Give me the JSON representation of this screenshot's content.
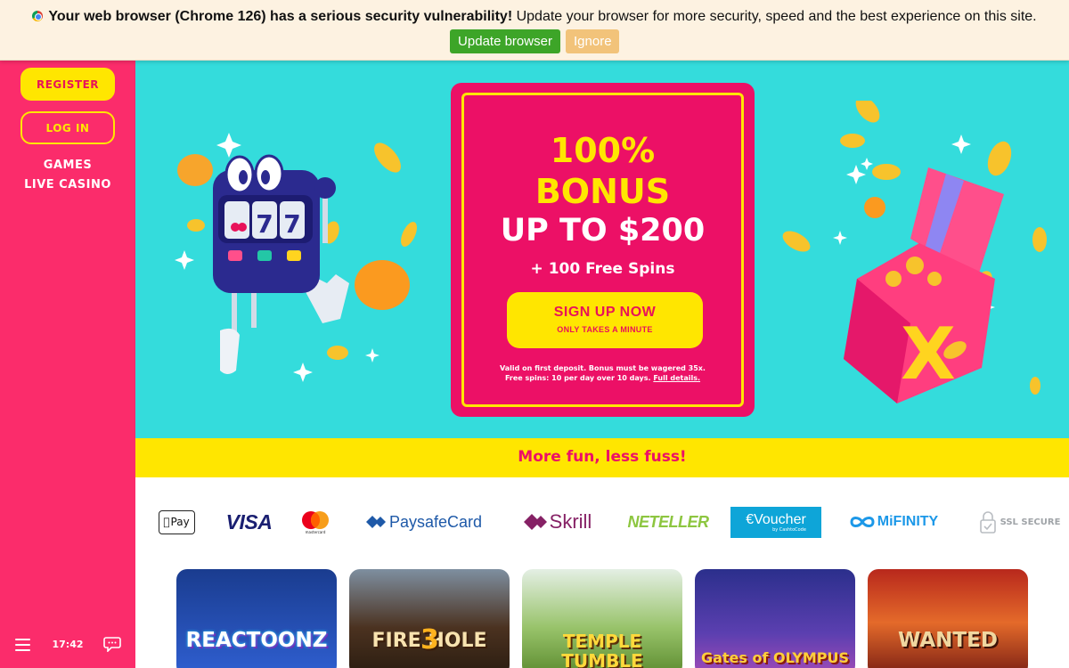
{
  "browser_bar": {
    "message_bold": "Your web browser (Chrome 126) has a serious security vulnerability!",
    "message_rest": " Update your browser for more security, speed and the best experience on this site.",
    "update_label": "Update browser",
    "ignore_label": "Ignore"
  },
  "sidebar": {
    "register_label": "REGISTER",
    "login_label": "LOG IN",
    "nav": [
      "GAMES",
      "LIVE CASINO"
    ],
    "clock": "17:42",
    "menu_icon": "hamburger-icon",
    "chat_icon": "chat-icon"
  },
  "hero": {
    "line1": "100%",
    "line2": "BONUS",
    "line3": "UP TO $200",
    "line4": "+ 100 Free Spins",
    "cta_title": "SIGN UP NOW",
    "cta_sub": "ONLY TAKES A MINUTE",
    "terms_line1": "Valid on first deposit. Bonus must be wagered 35x.",
    "terms_line2": "Free spins: 10 per day over 10 days.",
    "terms_link": "Full details."
  },
  "tagline": "More fun, less fuss!",
  "payments": {
    "applepay": "Pay",
    "visa": "VISA",
    "mastercard": "mastercard",
    "paysafecard": "PaysafeCard",
    "skrill": "Skrill",
    "neteller": "NETELLER",
    "evoucher": "Voucher",
    "evoucher_sub": "by CashtoCode",
    "mifinity": "MiFINITY",
    "ssl": "SSL SECURE"
  },
  "games": [
    "REACTOONZ",
    "FIRE HOLE",
    "TEMPLE TUMBLE",
    "Gates of OLYMPUS",
    "WANTED"
  ],
  "game_badges": {
    "fire_hole": "3"
  },
  "colors": {
    "sidebar": "#fb2c6b",
    "hero_bg": "#34dcdc",
    "accent_yellow": "#ffe600",
    "promo_pink": "#ec1066"
  }
}
